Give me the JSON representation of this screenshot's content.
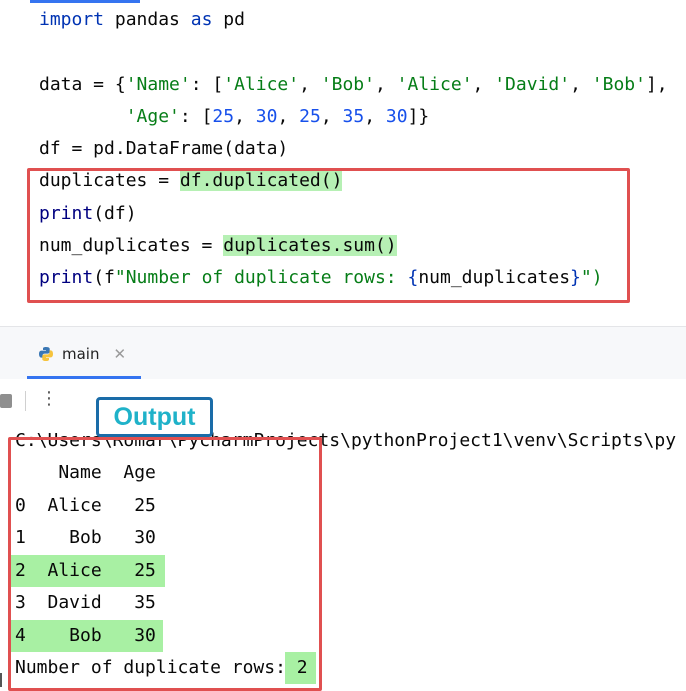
{
  "editor": {
    "lines": [
      [
        {
          "t": "import",
          "c": "kw"
        },
        {
          "t": " pandas ",
          "c": ""
        },
        {
          "t": "as",
          "c": "kw"
        },
        {
          "t": " pd",
          "c": ""
        }
      ],
      [],
      [
        {
          "t": "data = {",
          "c": ""
        },
        {
          "t": "'Name'",
          "c": "str"
        },
        {
          "t": ": [",
          "c": ""
        },
        {
          "t": "'Alice'",
          "c": "str"
        },
        {
          "t": ", ",
          "c": ""
        },
        {
          "t": "'Bob'",
          "c": "str"
        },
        {
          "t": ", ",
          "c": ""
        },
        {
          "t": "'Alice'",
          "c": "str"
        },
        {
          "t": ", ",
          "c": ""
        },
        {
          "t": "'David'",
          "c": "str"
        },
        {
          "t": ", ",
          "c": ""
        },
        {
          "t": "'Bob'",
          "c": "str"
        },
        {
          "t": "],",
          "c": ""
        }
      ],
      [
        {
          "t": "        ",
          "c": ""
        },
        {
          "t": "'Age'",
          "c": "str"
        },
        {
          "t": ": [",
          "c": ""
        },
        {
          "t": "25",
          "c": "num"
        },
        {
          "t": ", ",
          "c": ""
        },
        {
          "t": "30",
          "c": "num"
        },
        {
          "t": ", ",
          "c": ""
        },
        {
          "t": "25",
          "c": "num"
        },
        {
          "t": ", ",
          "c": ""
        },
        {
          "t": "35",
          "c": "num"
        },
        {
          "t": ", ",
          "c": ""
        },
        {
          "t": "30",
          "c": "num"
        },
        {
          "t": "]}",
          "c": ""
        }
      ],
      [
        {
          "t": "df = pd.DataFrame(data)",
          "c": ""
        }
      ],
      [
        {
          "t": "duplicates = ",
          "c": ""
        },
        {
          "t": "df.duplicated()",
          "c": "hl"
        }
      ],
      [
        {
          "t": "print",
          "c": "fn"
        },
        {
          "t": "(df)",
          "c": ""
        }
      ],
      [
        {
          "t": "num_duplicates = ",
          "c": ""
        },
        {
          "t": "duplicates.sum()",
          "c": "hl"
        }
      ],
      [
        {
          "t": "print",
          "c": "fn"
        },
        {
          "t": "(f",
          "c": ""
        },
        {
          "t": "\"Number of duplicate rows: ",
          "c": "str"
        },
        {
          "t": "{",
          "c": "kw"
        },
        {
          "t": "num_duplicates",
          "c": ""
        },
        {
          "t": "}",
          "c": "kw"
        },
        {
          "t": "\")",
          "c": "str"
        }
      ]
    ]
  },
  "run_tab": {
    "label": "main"
  },
  "output_label": "Output",
  "console": {
    "path": "C:\\Users\\Romar\\PycharmProjects\\pythonProject1\\venv\\Scripts\\py",
    "header": "    Name  Age",
    "rows": [
      "0  Alice   25",
      "1    Bob   30",
      "2  Alice   25",
      "3  David   35",
      "4    Bob   30"
    ],
    "summary_prefix": "Number of duplicate rows: ",
    "summary_value": "2"
  }
}
